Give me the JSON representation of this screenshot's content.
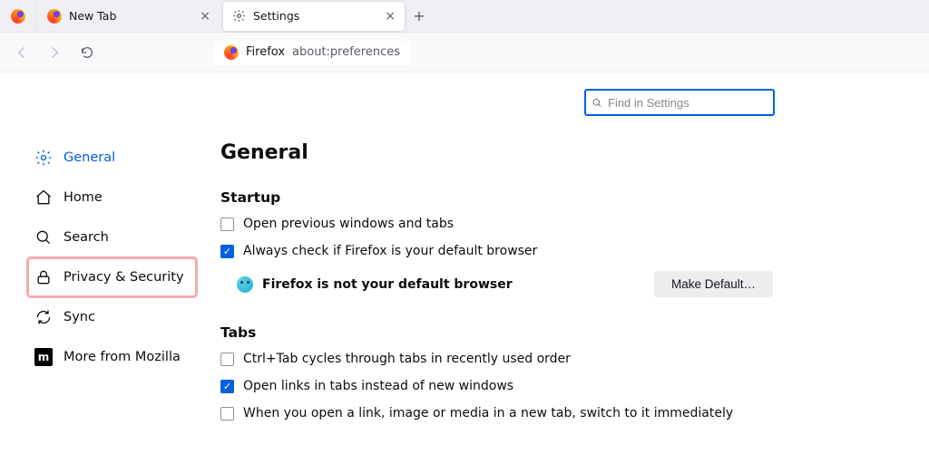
{
  "tabs": [
    {
      "label": "New Tab"
    },
    {
      "label": "Settings"
    }
  ],
  "toolbar": {
    "identity": "Firefox",
    "address": "about:preferences"
  },
  "search": {
    "placeholder": "Find in Settings"
  },
  "sidebar": {
    "items": [
      {
        "id": "general",
        "label": "General"
      },
      {
        "id": "home",
        "label": "Home"
      },
      {
        "id": "search",
        "label": "Search"
      },
      {
        "id": "privacy",
        "label": "Privacy & Security"
      },
      {
        "id": "sync",
        "label": "Sync"
      },
      {
        "id": "more",
        "label": "More from Mozilla"
      }
    ]
  },
  "page": {
    "title": "General",
    "startup": {
      "heading": "Startup",
      "open_previous": "Open previous windows and tabs",
      "always_check": "Always check if Firefox is your default browser",
      "status": "Firefox is not your default browser",
      "make_default": "Make Default…"
    },
    "tabs_section": {
      "heading": "Tabs",
      "ctrl_tab": "Ctrl+Tab cycles through tabs in recently used order",
      "open_links": "Open links in tabs instead of new windows",
      "switch_immediately": "When you open a link, image or media in a new tab, switch to it immediately"
    }
  }
}
